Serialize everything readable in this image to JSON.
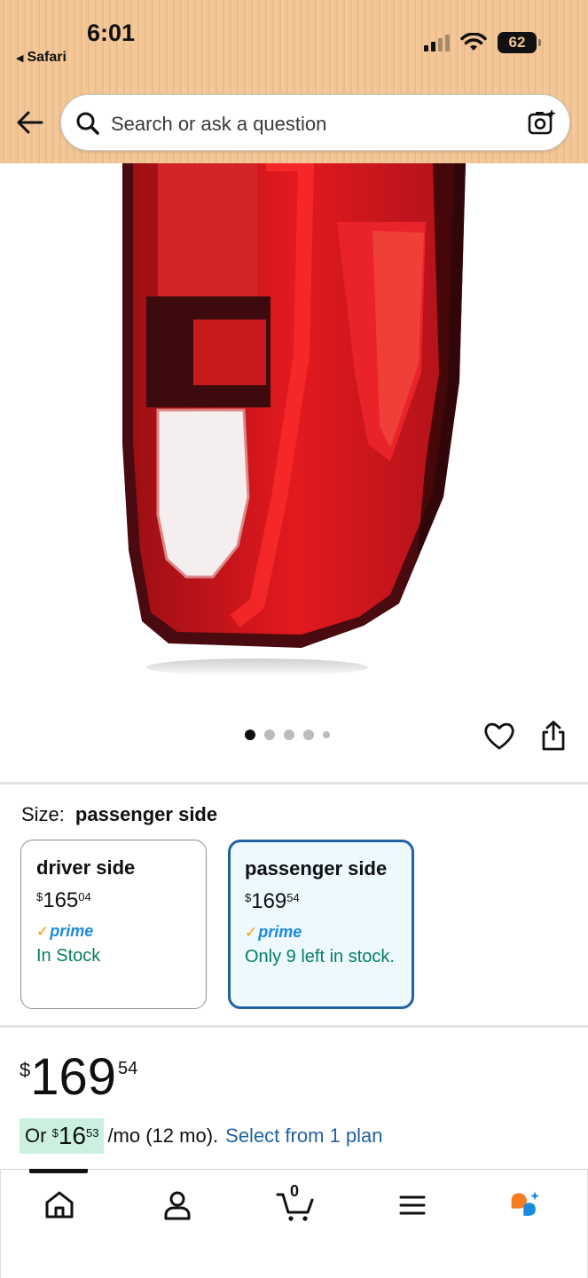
{
  "status_bar": {
    "time": "6:01",
    "back_app": "Safari",
    "battery": "62"
  },
  "search": {
    "placeholder": "Search or ask a question"
  },
  "gallery": {
    "dot_count": 5,
    "active_index": 0
  },
  "size": {
    "label": "Size:",
    "selected": "passenger side"
  },
  "variants": [
    {
      "name": "driver side",
      "currency": "$",
      "price_whole": "165",
      "price_fraction": "04",
      "prime": "prime",
      "stock": "In Stock",
      "selected": false
    },
    {
      "name": "passenger side",
      "currency": "$",
      "price_whole": "169",
      "price_fraction": "54",
      "prime": "prime",
      "stock": "Only 9 left in stock.",
      "selected": true
    }
  ],
  "price": {
    "currency": "$",
    "whole": "169",
    "fraction": "54"
  },
  "installment": {
    "prefix": "Or",
    "currency": "$",
    "whole": "16",
    "fraction": "53",
    "term": "/mo (12 mo).",
    "link": "Select from 1 plan"
  },
  "bottom_nav": {
    "cart_count": "0",
    "items": [
      "home-icon",
      "account-icon",
      "cart-icon",
      "menu-icon",
      "rufus-icon"
    ]
  },
  "colors": {
    "link": "#2162a1",
    "stock_green": "#067d62",
    "prime_blue": "#1a8ae0",
    "selected_border": "#2162a1",
    "installment_highlight": "#cbf0df"
  }
}
